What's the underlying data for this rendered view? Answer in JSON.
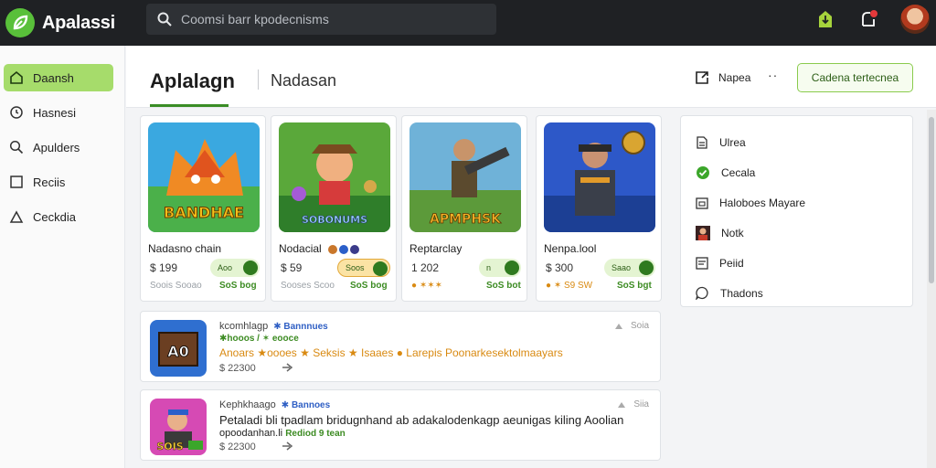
{
  "app": {
    "name": "Apalassi",
    "logo_icon": "leaf-logo-icon"
  },
  "search": {
    "placeholder": "Coomsi barr kpodecnisms"
  },
  "colors": {
    "accent": "#59c03a",
    "active_nav": "#a6dc6b",
    "topbar": "#1f2124",
    "link_green": "#3c8b22"
  },
  "sidebar": {
    "items": [
      {
        "label": "Daansh",
        "icon": "home-icon",
        "active": true
      },
      {
        "label": "Hasnesi",
        "icon": "clock-icon",
        "active": false
      },
      {
        "label": "Apulders",
        "icon": "search-icon",
        "active": false
      },
      {
        "label": "Reciis",
        "icon": "square-icon",
        "active": false
      },
      {
        "label": "Ceckdia",
        "icon": "triangle-icon",
        "active": false
      }
    ]
  },
  "header": {
    "title": "Aplalagn",
    "subtitle": "Nadasan",
    "action_label": "Napea",
    "more_label": "··",
    "cta_label": "Cadena tertecnea"
  },
  "cards": [
    {
      "art_label": "BANDHAE",
      "title": "Nadasno chain",
      "price": "$ 199",
      "pill": "Aoo",
      "meta": "Soois Sooao",
      "link": "SoS bog"
    },
    {
      "art_label": "SOBONUMS",
      "title": "Nodacial",
      "price": "$ 59",
      "pill": "Soos",
      "meta": "Sooses Scoo",
      "link": "SoS bog"
    },
    {
      "art_label": "APMPHSK",
      "title": "Reptarclay",
      "price": "1 202",
      "pill": "n",
      "meta": "● ✶✶✶",
      "link": "SoS bot"
    },
    {
      "art_label": "",
      "title": "Nenpa.lool",
      "price": "$ 300",
      "pill": "Saao",
      "meta": "● ✶ S9 SW",
      "link": "SoS bgt"
    }
  ],
  "panel": {
    "items": [
      {
        "label": "Ulrea",
        "icon": "document-icon"
      },
      {
        "label": "Cecala",
        "icon": "check-circle-icon"
      },
      {
        "label": "Haloboes Mayare",
        "icon": "calendar-icon"
      },
      {
        "label": "Notk",
        "icon": "avatar-icon"
      },
      {
        "label": "Peiid",
        "icon": "list-icon"
      },
      {
        "label": "Thadons",
        "icon": "chat-icon"
      }
    ]
  },
  "rows": [
    {
      "art_label": "A0",
      "title": "kcomhlagp",
      "badge": "✱ Bannnues",
      "subtitle": "✱hooos / ✶ eooce",
      "tags": "Anoars ★oooes ★ Seksis ★ Isaaes ● Larepis Poonarkesektolmaayars",
      "description": "",
      "meta": "$ 22300",
      "action": "Soia"
    },
    {
      "art_label": "SOIS",
      "title": "Kephkhaago",
      "badge": "✱ Bannoes",
      "subtitle": "",
      "tags": "",
      "description": "Petaladi bli tpadlam bridugnhand ab adakalodenkagp aeunigas kiling Aoolian",
      "description2": "opoodanhan.li",
      "description2_green": "Rediod 9 tean",
      "meta": "$ 22300",
      "action": "Siia"
    }
  ]
}
